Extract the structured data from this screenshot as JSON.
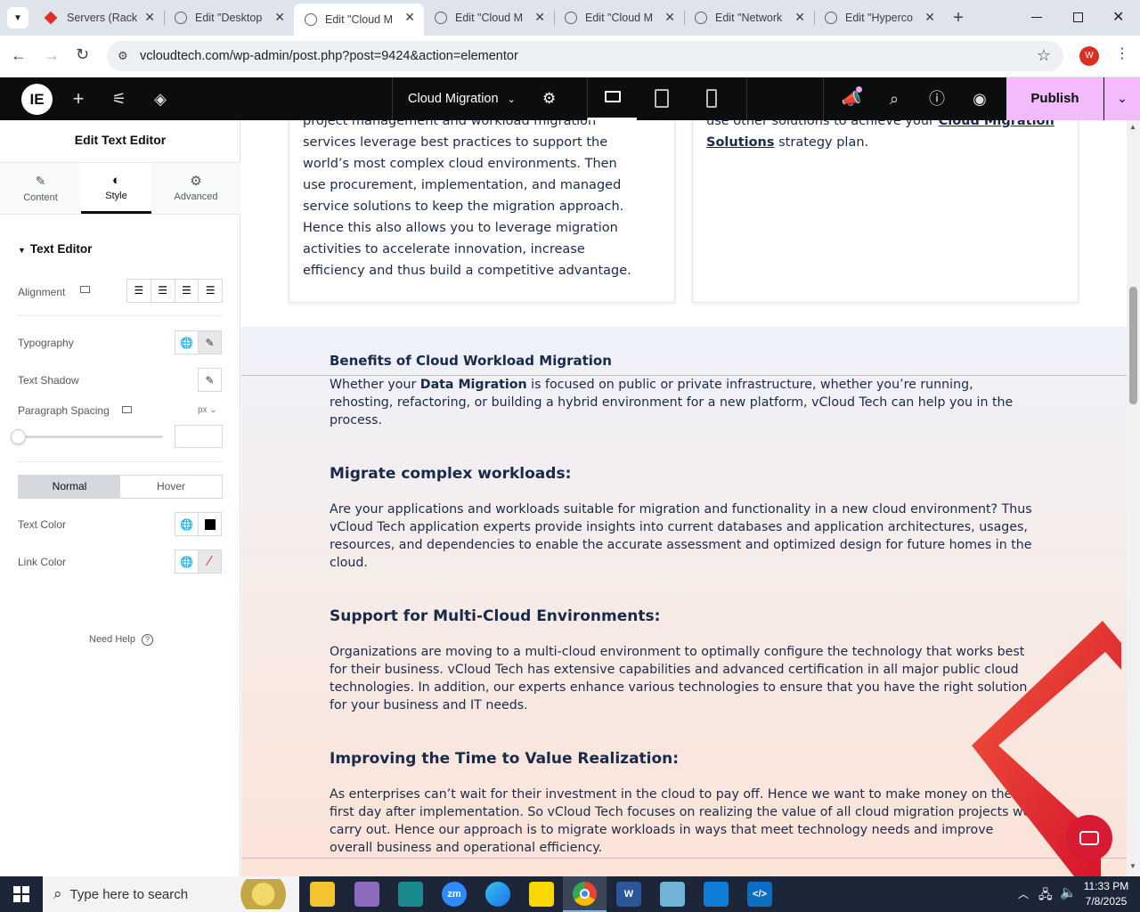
{
  "browser": {
    "tabs": [
      {
        "title": "Servers (Rack,",
        "icon": "tab-favicon-red-diamond"
      },
      {
        "title": "Edit \"Desktop",
        "icon": "wordpress-icon"
      },
      {
        "title": "Edit \"Cloud M",
        "icon": "wordpress-icon",
        "active": true
      },
      {
        "title": "Edit \"Cloud M",
        "icon": "wordpress-icon"
      },
      {
        "title": "Edit \"Cloud M",
        "icon": "wordpress-icon"
      },
      {
        "title": "Edit \"Network",
        "icon": "wordpress-icon"
      },
      {
        "title": "Edit \"Hyperco",
        "icon": "wordpress-icon"
      }
    ],
    "url": "vcloudtech.com/wp-admin/post.php?post=9424&action=elementor",
    "profile_initial": "W"
  },
  "elementor_top": {
    "page_title": "Cloud Migration",
    "publish_label": "Publish"
  },
  "panel": {
    "title": "Edit Text Editor",
    "tabs": [
      "Content",
      "Style",
      "Advanced"
    ],
    "section_title": "Text Editor",
    "alignment_label": "Alignment",
    "typography_label": "Typography",
    "text_shadow_label": "Text Shadow",
    "paragraph_spacing_label": "Paragraph Spacing",
    "unit": "px",
    "state_normal": "Normal",
    "state_hover": "Hover",
    "text_color_label": "Text Color",
    "link_color_label": "Link Color",
    "need_help": "Need Help",
    "colors": {
      "text_color": "#000000"
    }
  },
  "canvas": {
    "card_left_lines": [
      "project management and workload migration",
      "services leverage best practices to support the",
      "world’s most complex cloud environments. Then",
      "use procurement, implementation, and managed",
      "service solutions to keep the migration approach.",
      "Hence this also allows you to leverage migration",
      "activities to accelerate innovation, increase",
      "efficiency and thus build a competitive advantage."
    ],
    "card_right_pre": "use other solutions to achieve your ",
    "card_right_link1": "Cloud Migration",
    "card_right_link2": "Solutions",
    "card_right_post": " strategy plan.",
    "benefits_heading": "Benefits of Cloud Workload Migration",
    "intro_pre": "Whether your ",
    "intro_bold": "Data Migration",
    "intro_post": " is focused on public or private infrastructure, whether you’re running, rehosting, refactoring, or building a hybrid environment for a new platform, vCloud Tech can help you in the process.",
    "sections": [
      {
        "heading": "Migrate complex workloads:",
        "body": "Are your applications and workloads suitable for migration and functionality in a new cloud environment? Thus vCloud Tech application experts provide insights into current databases and application architectures, usages, resources, and dependencies to enable the accurate assessment and optimized design for future homes in the cloud."
      },
      {
        "heading": "Support for Multi-Cloud Environments:",
        "body": "Organizations are moving to a multi-cloud environment to optimally configure the technology that works best for their business. vCloud Tech has extensive capabilities and advanced certification in all major public cloud technologies. In addition, our experts enhance various technologies to ensure that you have the right solution for your business and IT needs."
      },
      {
        "heading": "Improving the Time to Value Realization:",
        "body": "As enterprises can’t wait for their investment in the cloud to pay off. Hence we want to make money on the first day after implementation. So vCloud Tech focuses on realizing the value of all cloud migration projects we carry out. Hence our approach is to migrate workloads in ways that meet technology needs and improve overall business and operational efficiency."
      }
    ]
  },
  "taskbar": {
    "search_placeholder": "Type here to search",
    "time": "11:33 PM",
    "date": "7/8/2025"
  }
}
